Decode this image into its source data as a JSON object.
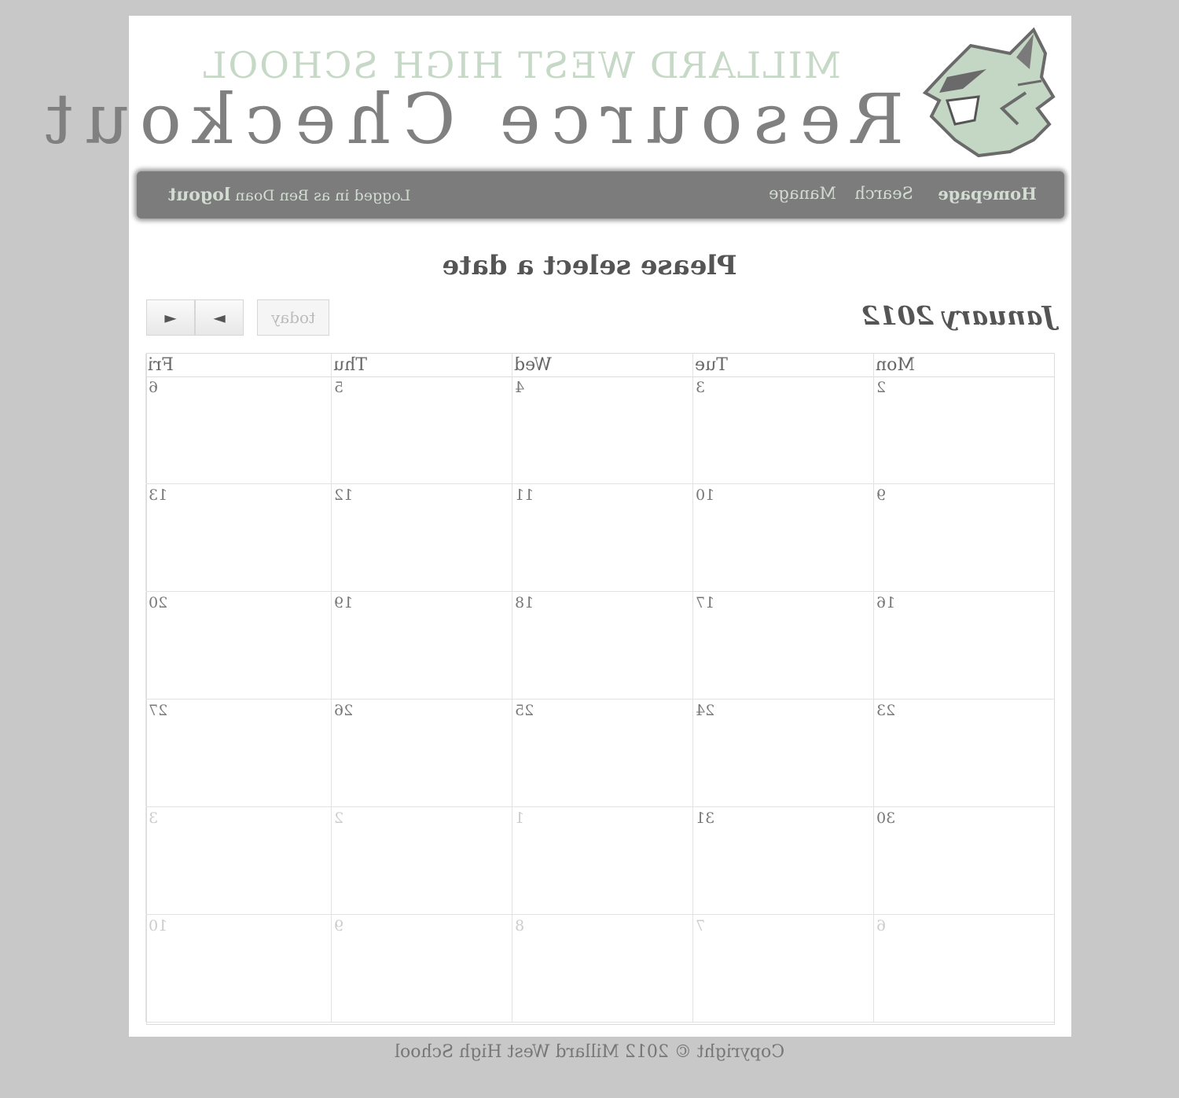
{
  "header": {
    "school": "MILLARD WEST HIGH SCHOOL",
    "title": "Resource Checkout"
  },
  "nav": {
    "home": "Homepage",
    "search": "Search",
    "manage": "Manage",
    "logged_in_text": "Logged in as Ben Doan",
    "logout": "logout"
  },
  "main": {
    "heading": "Please select a date",
    "month_title": "January 2012",
    "today_label": "today",
    "prev_glyph": "◄",
    "next_glyph": "►"
  },
  "calendar": {
    "days_of_week": [
      "Mon",
      "Tue",
      "Wed",
      "Thu",
      "Fri"
    ],
    "weeks": [
      [
        {
          "n": "2",
          "other": false
        },
        {
          "n": "3",
          "other": false
        },
        {
          "n": "4",
          "other": false
        },
        {
          "n": "5",
          "other": false
        },
        {
          "n": "6",
          "other": false
        }
      ],
      [
        {
          "n": "9",
          "other": false
        },
        {
          "n": "10",
          "other": false
        },
        {
          "n": "11",
          "other": false
        },
        {
          "n": "12",
          "other": false
        },
        {
          "n": "13",
          "other": false
        }
      ],
      [
        {
          "n": "16",
          "other": false
        },
        {
          "n": "17",
          "other": false
        },
        {
          "n": "18",
          "other": false
        },
        {
          "n": "19",
          "other": false
        },
        {
          "n": "20",
          "other": false
        }
      ],
      [
        {
          "n": "23",
          "other": false
        },
        {
          "n": "24",
          "other": false
        },
        {
          "n": "25",
          "other": false
        },
        {
          "n": "26",
          "other": false
        },
        {
          "n": "27",
          "other": false
        }
      ],
      [
        {
          "n": "30",
          "other": false
        },
        {
          "n": "31",
          "other": false
        },
        {
          "n": "1",
          "other": true
        },
        {
          "n": "2",
          "other": true
        },
        {
          "n": "3",
          "other": true
        }
      ],
      [
        {
          "n": "6",
          "other": true
        },
        {
          "n": "7",
          "other": true
        },
        {
          "n": "8",
          "other": true
        },
        {
          "n": "9",
          "other": true
        },
        {
          "n": "10",
          "other": true
        }
      ]
    ]
  },
  "footer": {
    "text": "Copyright © 2012 Millard West High School"
  },
  "colors": {
    "accent_green": "#c6d8c6",
    "nav_bg": "#7c7c7c",
    "page_bg": "#c8c8c8"
  },
  "icons": {
    "mascot": "wildcat-mascot-icon"
  }
}
